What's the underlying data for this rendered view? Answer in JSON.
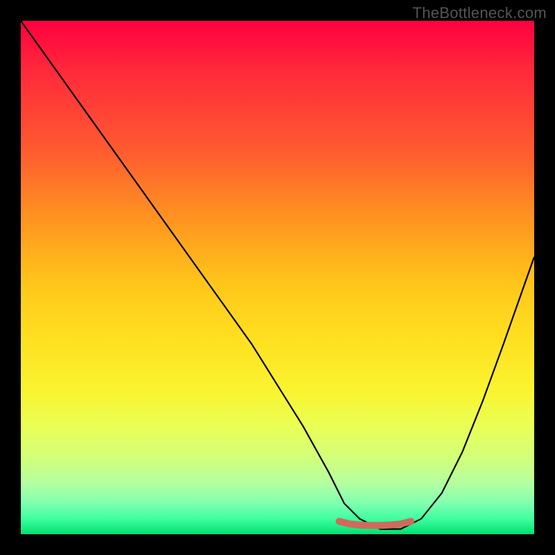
{
  "watermark": "TheBottleneck.com",
  "chart_data": {
    "type": "line",
    "title": "",
    "xlabel": "",
    "ylabel": "",
    "xlim": [
      0,
      100
    ],
    "ylim": [
      0,
      100
    ],
    "grid": false,
    "legend": false,
    "background": {
      "style": "vertical-gradient",
      "stops": [
        {
          "pos": 0,
          "color": "#ff0040"
        },
        {
          "pos": 25,
          "color": "#ff5a30"
        },
        {
          "pos": 50,
          "color": "#ffc81a"
        },
        {
          "pos": 75,
          "color": "#f0ff40"
        },
        {
          "pos": 100,
          "color": "#00e070"
        }
      ]
    },
    "series": [
      {
        "name": "bottleneck-curve",
        "color": "#000000",
        "x": [
          0,
          5,
          10,
          15,
          20,
          25,
          30,
          35,
          40,
          45,
          50,
          55,
          60,
          63,
          66,
          70,
          74,
          78,
          82,
          86,
          90,
          94,
          100
        ],
        "values": [
          100,
          93,
          86,
          79,
          72,
          65,
          58,
          51,
          44,
          37,
          29,
          21,
          12,
          6,
          3,
          1,
          1,
          3,
          8,
          16,
          26,
          37,
          54
        ]
      },
      {
        "name": "optimal-zone-marker",
        "color": "#d46a5a",
        "style": "thick-flat",
        "x": [
          62,
          64,
          66,
          68,
          70,
          72,
          74,
          76
        ],
        "values": [
          2.5,
          2,
          1.8,
          1.7,
          1.7,
          1.8,
          2,
          2.5
        ]
      }
    ],
    "annotations": []
  }
}
